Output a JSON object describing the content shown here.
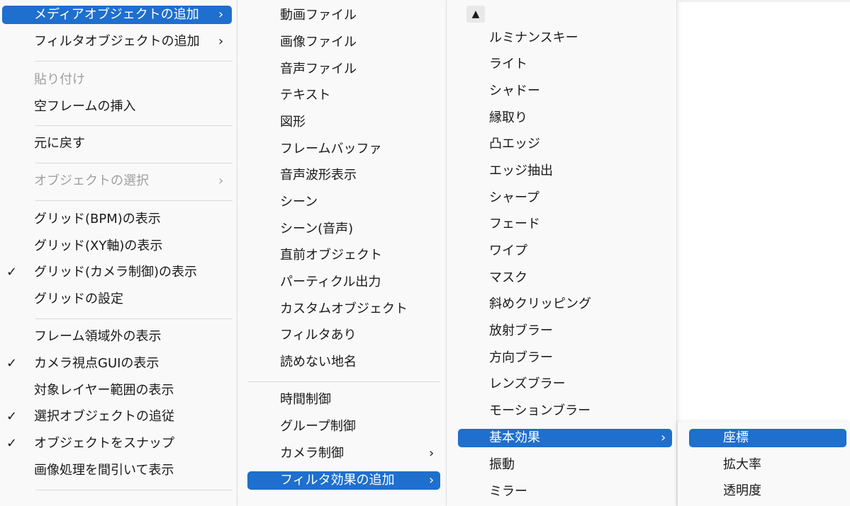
{
  "menu1": {
    "add_media_object": "メディアオブジェクトの追加",
    "add_filter_object": "フィルタオブジェクトの追加",
    "paste": "貼り付け",
    "insert_empty_frame": "空フレームの挿入",
    "undo": "元に戻す",
    "select_objects": "オブジェクトの選択",
    "grid_bpm": "グリッド(BPM)の表示",
    "grid_xy": "グリッド(XY軸)の表示",
    "grid_camera": "グリッド(カメラ制御)の表示",
    "grid_settings": "グリッドの設定",
    "show_outside_frame": "フレーム領域外の表示",
    "camera_gui": "カメラ視点GUIの表示",
    "target_layer_range": "対象レイヤー範囲の表示",
    "follow_selected": "選択オブジェクトの追従",
    "snap_objects": "オブジェクトをスナップ",
    "thin_image_processing": "画像処理を間引いて表示",
    "chevron": "›",
    "check": "✓"
  },
  "menu2": {
    "video_file": "動画ファイル",
    "image_file": "画像ファイル",
    "audio_file": "音声ファイル",
    "text": "テキスト",
    "shape": "図形",
    "frame_buffer": "フレームバッファ",
    "audio_waveform": "音声波形表示",
    "scene": "シーン",
    "scene_audio": "シーン(音声)",
    "previous_object": "直前オブジェクト",
    "particle_output": "パーティクル出力",
    "custom_object": "カスタムオブジェクト",
    "with_filter": "フィルタあり",
    "unreadable_place": "読めない地名",
    "time_control": "時間制御",
    "group_control": "グループ制御",
    "camera_control": "カメラ制御",
    "add_filter_effect": "フィルタ効果の追加",
    "chevron": "›"
  },
  "menu3": {
    "scroll_up": "▲",
    "luminance_key": "ルミナンスキー",
    "light": "ライト",
    "shadow": "シャドー",
    "border": "縁取り",
    "emboss_edge": "凸エッジ",
    "edge_extract": "エッジ抽出",
    "sharpen": "シャープ",
    "fade": "フェード",
    "wipe": "ワイプ",
    "mask": "マスク",
    "diagonal_clipping": "斜めクリッピング",
    "radial_blur": "放射ブラー",
    "directional_blur": "方向ブラー",
    "lens_blur": "レンズブラー",
    "motion_blur": "モーションブラー",
    "basic_effects": "基本効果",
    "vibration": "振動",
    "mirror": "ミラー",
    "chevron": "›"
  },
  "menu4": {
    "coordinates": "座標",
    "scale": "拡大率",
    "opacity": "透明度"
  },
  "colors": {
    "highlight": "#1e6fce",
    "menu_bg": "#f9f9f9",
    "disabled_text": "#a0a0a0",
    "separator": "#d9d9d9"
  }
}
